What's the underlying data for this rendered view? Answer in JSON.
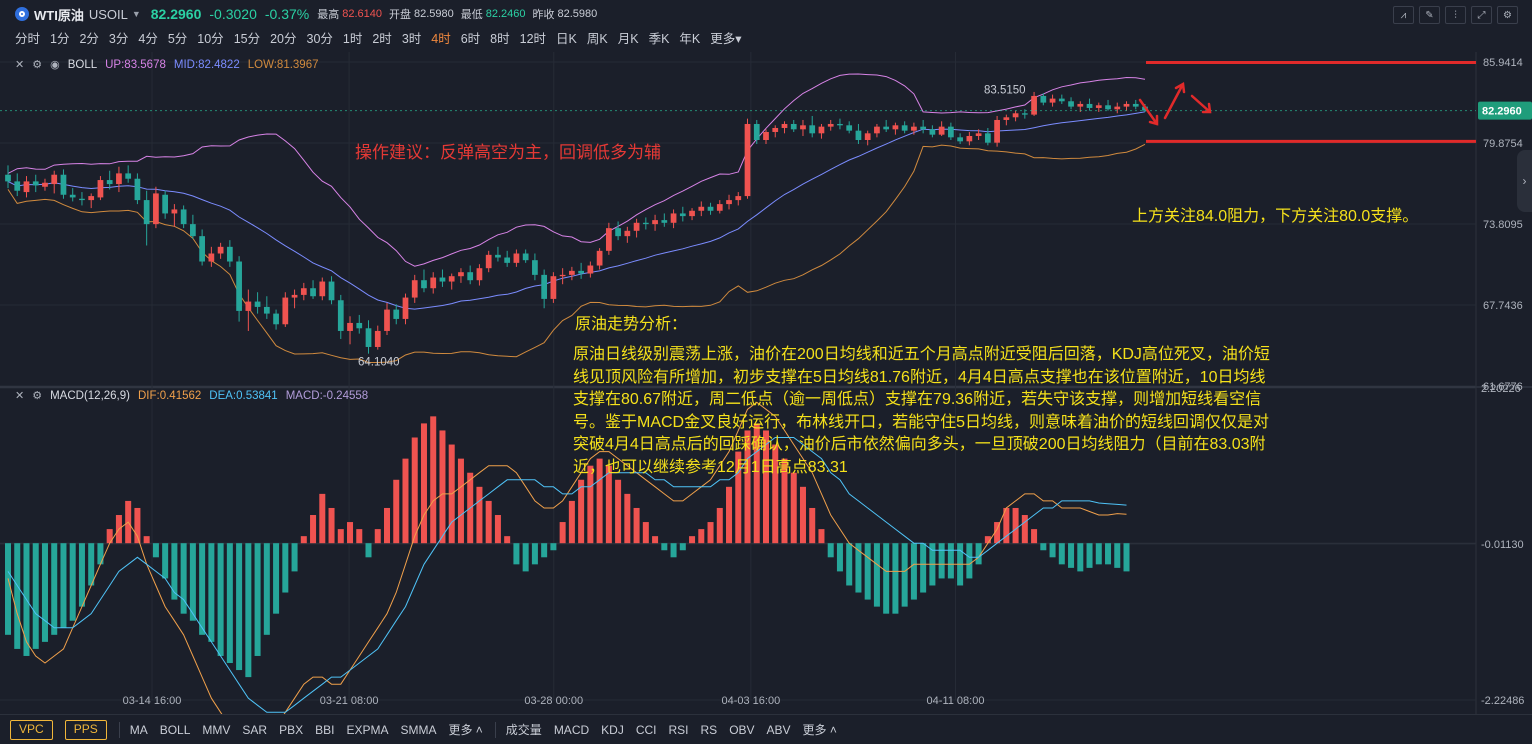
{
  "header": {
    "symbol_name": "WTI原油",
    "symbol_code": "USOIL",
    "price": "82.2960",
    "change": "-0.3020",
    "change_pct": "-0.37%",
    "high_label": "最高",
    "high": "82.6140",
    "open_label": "开盘",
    "open": "82.5980",
    "low_label": "最低",
    "low": "82.2460",
    "prev_label": "昨收",
    "prev": "82.5980"
  },
  "periods": [
    "分时",
    "1分",
    "2分",
    "3分",
    "4分",
    "5分",
    "10分",
    "15分",
    "20分",
    "30分",
    "1时",
    "2时",
    "3时",
    "4时",
    "6时",
    "8时",
    "12时",
    "日K",
    "周K",
    "月K",
    "季K",
    "年K",
    "更多"
  ],
  "active_period": "4时",
  "boll": {
    "name": "BOLL",
    "up": "UP:83.5678",
    "mid": "MID:82.4822",
    "low": "LOW:81.3967"
  },
  "macd": {
    "name": "MACD(12,26,9)",
    "dif": "DIF:0.41562",
    "dea": "DEA:0.53841",
    "macd": "MACD:-0.24558"
  },
  "colors": {
    "up": "#ef5350",
    "down": "#26a69a",
    "boll_up": "#d783e6",
    "boll_mid": "#7b8cff",
    "boll_low": "#d08a3e",
    "dif": "#f0a04b",
    "dea": "#4fc3f7",
    "annotation": "#e53935",
    "text_note": "#f5e11b"
  },
  "chart_data": {
    "type": "candlestick",
    "main_yaxis_ticks": [
      "85.9414",
      "79.8754",
      "73.8095",
      "67.7436",
      "61.6776"
    ],
    "main_ylim": [
      61.6776,
      85.9414
    ],
    "current_price_tag": "82.2960",
    "macd_yaxis_ticks": [
      "2.20226",
      "-0.01130",
      "-2.22486"
    ],
    "macd_ylim": [
      -2.22486,
      2.20226
    ],
    "xaxis_ticks": [
      "03-14 16:00",
      "03-21 08:00",
      "03-28 00:00",
      "04-03 16:00",
      "04-11 08:00"
    ],
    "high_marker": "83.5150",
    "low_marker": "64.1040",
    "resistance_level": 85.9,
    "support_level": 80.0,
    "candles": [
      [
        77.5,
        78.2,
        76.5,
        77.0
      ],
      [
        77.0,
        77.6,
        75.9,
        76.3
      ],
      [
        76.2,
        77.4,
        75.8,
        77.0
      ],
      [
        77.0,
        77.5,
        76.2,
        76.7
      ],
      [
        76.6,
        77.2,
        76.3,
        76.9
      ],
      [
        76.8,
        77.8,
        76.1,
        77.5
      ],
      [
        77.5,
        77.9,
        75.7,
        76.0
      ],
      [
        76.0,
        76.5,
        75.5,
        75.8
      ],
      [
        75.7,
        76.2,
        75.2,
        75.6
      ],
      [
        75.6,
        76.1,
        75.0,
        75.9
      ],
      [
        75.8,
        77.4,
        75.6,
        77.1
      ],
      [
        77.1,
        77.8,
        76.4,
        76.8
      ],
      [
        76.8,
        78.1,
        76.2,
        77.6
      ],
      [
        77.6,
        78.2,
        76.9,
        77.2
      ],
      [
        77.2,
        77.6,
        75.3,
        75.6
      ],
      [
        75.6,
        76.3,
        72.2,
        73.8
      ],
      [
        73.8,
        76.6,
        73.5,
        76.1
      ],
      [
        76.0,
        76.3,
        74.2,
        74.6
      ],
      [
        74.6,
        75.3,
        73.6,
        74.9
      ],
      [
        74.9,
        75.2,
        73.5,
        73.8
      ],
      [
        73.8,
        74.5,
        72.7,
        72.9
      ],
      [
        72.9,
        73.4,
        70.7,
        71.0
      ],
      [
        71.0,
        72.1,
        70.6,
        71.6
      ],
      [
        71.6,
        72.4,
        71.2,
        72.1
      ],
      [
        72.1,
        72.6,
        70.6,
        71.0
      ],
      [
        71.0,
        71.4,
        66.5,
        67.3
      ],
      [
        67.3,
        68.9,
        65.8,
        68.0
      ],
      [
        68.0,
        68.7,
        67.1,
        67.6
      ],
      [
        67.6,
        68.4,
        66.7,
        67.1
      ],
      [
        67.1,
        67.4,
        65.9,
        66.3
      ],
      [
        66.3,
        68.7,
        66.1,
        68.3
      ],
      [
        68.3,
        68.9,
        67.5,
        68.5
      ],
      [
        68.5,
        69.4,
        68.1,
        69.0
      ],
      [
        69.0,
        69.6,
        68.2,
        68.4
      ],
      [
        68.4,
        69.8,
        68.1,
        69.5
      ],
      [
        69.5,
        69.9,
        67.8,
        68.1
      ],
      [
        68.1,
        68.5,
        65.2,
        65.8
      ],
      [
        65.8,
        66.9,
        64.8,
        66.4
      ],
      [
        66.4,
        67.0,
        65.6,
        66.0
      ],
      [
        66.0,
        66.6,
        64.1,
        64.6
      ],
      [
        64.6,
        66.2,
        64.4,
        65.8
      ],
      [
        65.8,
        67.9,
        65.5,
        67.4
      ],
      [
        67.4,
        67.8,
        66.3,
        66.7
      ],
      [
        66.7,
        68.6,
        66.3,
        68.3
      ],
      [
        68.3,
        70.0,
        67.9,
        69.6
      ],
      [
        69.6,
        70.4,
        68.7,
        69.0
      ],
      [
        69.0,
        70.2,
        68.6,
        69.8
      ],
      [
        69.8,
        70.4,
        69.1,
        69.5
      ],
      [
        69.5,
        70.1,
        68.9,
        69.9
      ],
      [
        69.9,
        70.5,
        69.4,
        70.2
      ],
      [
        70.2,
        70.7,
        69.3,
        69.6
      ],
      [
        69.6,
        70.8,
        69.2,
        70.5
      ],
      [
        70.5,
        71.8,
        70.2,
        71.5
      ],
      [
        71.5,
        72.1,
        71.0,
        71.3
      ],
      [
        71.3,
        71.8,
        70.6,
        70.9
      ],
      [
        70.9,
        71.9,
        70.6,
        71.6
      ],
      [
        71.6,
        71.9,
        70.9,
        71.1
      ],
      [
        71.1,
        71.6,
        69.6,
        70.0
      ],
      [
        70.0,
        70.4,
        67.5,
        68.2
      ],
      [
        68.2,
        70.2,
        67.9,
        69.9
      ],
      [
        69.9,
        70.5,
        69.3,
        70.0
      ],
      [
        70.0,
        70.6,
        69.6,
        70.3
      ],
      [
        70.3,
        70.9,
        69.7,
        70.1
      ],
      [
        70.1,
        71.0,
        69.8,
        70.7
      ],
      [
        70.7,
        72.0,
        70.4,
        71.8
      ],
      [
        71.8,
        73.9,
        71.5,
        73.5
      ],
      [
        73.5,
        74.0,
        72.6,
        72.9
      ],
      [
        72.9,
        73.6,
        72.4,
        73.3
      ],
      [
        73.3,
        74.2,
        72.8,
        73.9
      ],
      [
        73.9,
        74.3,
        73.4,
        73.8
      ],
      [
        73.8,
        74.5,
        73.3,
        74.1
      ],
      [
        74.1,
        74.6,
        73.6,
        73.9
      ],
      [
        73.9,
        74.9,
        73.5,
        74.6
      ],
      [
        74.6,
        75.1,
        74.0,
        74.4
      ],
      [
        74.4,
        75.0,
        74.1,
        74.8
      ],
      [
        74.8,
        75.5,
        74.4,
        75.1
      ],
      [
        75.1,
        75.4,
        74.5,
        74.8
      ],
      [
        74.8,
        75.6,
        74.6,
        75.3
      ],
      [
        75.3,
        76.0,
        74.9,
        75.6
      ],
      [
        75.6,
        76.2,
        75.2,
        75.9
      ],
      [
        75.9,
        81.7,
        75.7,
        81.3
      ],
      [
        81.3,
        81.6,
        79.8,
        80.1
      ],
      [
        80.1,
        80.9,
        79.8,
        80.7
      ],
      [
        80.7,
        81.2,
        80.3,
        81.0
      ],
      [
        81.0,
        81.5,
        80.6,
        81.3
      ],
      [
        81.3,
        81.6,
        80.7,
        80.9
      ],
      [
        80.9,
        81.6,
        80.4,
        81.2
      ],
      [
        81.2,
        81.9,
        80.3,
        80.6
      ],
      [
        80.6,
        81.3,
        80.2,
        81.1
      ],
      [
        81.1,
        81.6,
        80.8,
        81.3
      ],
      [
        81.3,
        81.7,
        80.9,
        81.2
      ],
      [
        81.2,
        81.5,
        80.6,
        80.8
      ],
      [
        80.8,
        81.3,
        79.8,
        80.1
      ],
      [
        80.1,
        80.8,
        79.7,
        80.6
      ],
      [
        80.6,
        81.3,
        80.3,
        81.1
      ],
      [
        81.1,
        81.6,
        80.7,
        80.9
      ],
      [
        80.9,
        81.4,
        80.5,
        81.2
      ],
      [
        81.2,
        81.5,
        80.6,
        80.8
      ],
      [
        80.8,
        81.4,
        80.5,
        81.1
      ],
      [
        81.1,
        81.6,
        80.6,
        80.9
      ],
      [
        80.9,
        81.2,
        80.3,
        80.5
      ],
      [
        80.5,
        81.5,
        80.4,
        81.1
      ],
      [
        81.1,
        81.4,
        80.1,
        80.3
      ],
      [
        80.3,
        80.6,
        79.8,
        80.0
      ],
      [
        80.0,
        80.7,
        79.7,
        80.4
      ],
      [
        80.4,
        80.9,
        80.1,
        80.6
      ],
      [
        80.6,
        81.0,
        79.7,
        79.9
      ],
      [
        79.9,
        81.9,
        79.6,
        81.6
      ],
      [
        81.6,
        82.0,
        81.2,
        81.8
      ],
      [
        81.8,
        82.3,
        81.5,
        82.1
      ],
      [
        82.1,
        82.4,
        81.7,
        82.0
      ],
      [
        82.0,
        83.7,
        81.9,
        83.4
      ],
      [
        83.4,
        83.6,
        82.7,
        82.9
      ],
      [
        82.9,
        83.5,
        82.6,
        83.2
      ],
      [
        83.2,
        83.5,
        82.8,
        83.0
      ],
      [
        83.0,
        83.3,
        82.4,
        82.6
      ],
      [
        82.6,
        83.0,
        82.2,
        82.8
      ],
      [
        82.8,
        83.2,
        82.3,
        82.5
      ],
      [
        82.5,
        82.9,
        82.2,
        82.7
      ],
      [
        82.7,
        83.1,
        82.3,
        82.4
      ],
      [
        82.4,
        82.9,
        82.1,
        82.6
      ],
      [
        82.6,
        83.0,
        82.3,
        82.8
      ],
      [
        82.8,
        83.1,
        82.4,
        82.6
      ],
      [
        82.6,
        82.8,
        82.2,
        82.3
      ]
    ],
    "macd_hist": [
      -1.3,
      -1.5,
      -1.6,
      -1.5,
      -1.4,
      -1.3,
      -1.2,
      -1.1,
      -0.9,
      -0.6,
      -0.3,
      0.2,
      0.4,
      0.6,
      0.5,
      0.1,
      -0.2,
      -0.5,
      -0.8,
      -1.0,
      -1.1,
      -1.3,
      -1.4,
      -1.6,
      -1.7,
      -1.8,
      -1.9,
      -1.6,
      -1.3,
      -1.0,
      -0.7,
      -0.4,
      0.1,
      0.4,
      0.7,
      0.5,
      0.2,
      0.3,
      0.2,
      -0.2,
      0.2,
      0.5,
      0.9,
      1.2,
      1.5,
      1.7,
      1.8,
      1.6,
      1.4,
      1.2,
      1.0,
      0.8,
      0.6,
      0.4,
      0.1,
      -0.3,
      -0.4,
      -0.3,
      -0.2,
      -0.1,
      0.3,
      0.6,
      0.9,
      1.1,
      1.2,
      1.1,
      0.9,
      0.7,
      0.5,
      0.3,
      0.1,
      -0.1,
      -0.2,
      -0.1,
      0.1,
      0.2,
      0.3,
      0.5,
      0.8,
      1.3,
      1.6,
      1.7,
      1.6,
      1.4,
      1.2,
      1.0,
      0.8,
      0.5,
      0.2,
      -0.2,
      -0.4,
      -0.6,
      -0.7,
      -0.8,
      -0.9,
      -1.0,
      -1.0,
      -0.9,
      -0.8,
      -0.7,
      -0.6,
      -0.5,
      -0.5,
      -0.6,
      -0.5,
      -0.3,
      0.1,
      0.3,
      0.5,
      0.5,
      0.4,
      0.2,
      -0.1,
      -0.2,
      -0.3,
      -0.35,
      -0.4,
      -0.35,
      -0.3,
      -0.3,
      -0.35,
      -0.4
    ],
    "dif": [
      -0.5,
      -1.0,
      -1.4,
      -1.6,
      -1.7,
      -1.6,
      -1.5,
      -1.2,
      -0.9,
      -0.6,
      -0.3,
      0.0,
      0.2,
      0.3,
      0.1,
      -0.3,
      -0.6,
      -0.9,
      -1.1,
      -1.3,
      -1.6,
      -1.9,
      -2.2,
      -2.4,
      -2.6,
      -2.8,
      -2.9,
      -2.9,
      -2.8,
      -2.6,
      -2.4,
      -2.2,
      -2.0,
      -1.9,
      -1.9,
      -2.0,
      -2.0,
      -1.8,
      -1.6,
      -1.4,
      -1.2,
      -1.0,
      -0.7,
      -0.3,
      0.1,
      0.4,
      0.6,
      0.7,
      0.7,
      0.8,
      0.9,
      1.0,
      1.1,
      1.1,
      1.1,
      1.0,
      0.8,
      0.6,
      0.5,
      0.5,
      0.6,
      0.8,
      1.0,
      1.2,
      1.3,
      1.3,
      1.2,
      1.1,
      1.0,
      0.9,
      0.8,
      0.7,
      0.6,
      0.6,
      0.7,
      0.8,
      0.9,
      1.1,
      1.3,
      1.6,
      1.9,
      2.0,
      1.9,
      1.8,
      1.6,
      1.4,
      1.2,
      1.0,
      0.7,
      0.4,
      0.2,
      0.0,
      -0.1,
      -0.2,
      -0.3,
      -0.4,
      -0.4,
      -0.4,
      -0.3,
      -0.3,
      -0.3,
      -0.3,
      -0.3,
      -0.3,
      -0.3,
      -0.2,
      0.0,
      0.2,
      0.5,
      0.6,
      0.7,
      0.7,
      0.6,
      0.6,
      0.5,
      0.5,
      0.5,
      0.45,
      0.4,
      0.4,
      0.42,
      0.41
    ],
    "dea": [
      -0.4,
      -0.6,
      -0.8,
      -1.0,
      -1.1,
      -1.2,
      -1.2,
      -1.2,
      -1.1,
      -1.0,
      -0.8,
      -0.6,
      -0.4,
      -0.3,
      -0.2,
      -0.3,
      -0.4,
      -0.5,
      -0.7,
      -0.8,
      -1.0,
      -1.2,
      -1.4,
      -1.6,
      -1.8,
      -2.0,
      -2.2,
      -2.3,
      -2.4,
      -2.4,
      -2.4,
      -2.3,
      -2.2,
      -2.1,
      -2.0,
      -1.9,
      -1.9,
      -1.8,
      -1.7,
      -1.6,
      -1.5,
      -1.3,
      -1.1,
      -0.9,
      -0.6,
      -0.3,
      -0.1,
      0.1,
      0.3,
      0.4,
      0.5,
      0.6,
      0.7,
      0.8,
      0.9,
      0.9,
      0.9,
      0.9,
      0.8,
      0.8,
      0.7,
      0.7,
      0.8,
      0.8,
      0.9,
      1.0,
      1.0,
      1.0,
      1.0,
      1.0,
      0.9,
      0.9,
      0.8,
      0.8,
      0.8,
      0.8,
      0.8,
      0.9,
      0.9,
      1.0,
      1.2,
      1.3,
      1.4,
      1.5,
      1.5,
      1.5,
      1.4,
      1.3,
      1.2,
      1.0,
      0.9,
      0.7,
      0.6,
      0.5,
      0.4,
      0.3,
      0.2,
      0.1,
      0.0,
      0.0,
      -0.1,
      -0.1,
      -0.1,
      -0.1,
      -0.2,
      -0.2,
      -0.1,
      0.0,
      0.1,
      0.2,
      0.3,
      0.4,
      0.5,
      0.5,
      0.6,
      0.6,
      0.6,
      0.6,
      0.57,
      0.56,
      0.55,
      0.54
    ]
  },
  "annotations": {
    "advice": "操作建议：反弹高空为主，回调低多为辅",
    "levels_note": "上方关注84.0阻力，下方关注80.0支撑。",
    "analysis_title": "原油走势分析：",
    "analysis_body": "原油日线级别震荡上涨，油价在200日均线和近五个月高点附近受阻后回落，KDJ高位死叉，油价短线见顶风险有所增加，初步支撑在5日均线81.76附近，4月4日高点支撑也在该位置附近，10日均线支撑在80.67附近，周二低点（逾一周低点）支撑在79.36附近，若失守该支撑，则增加短线看空信号。鉴于MACD金叉良好运行，布林线开口，若能守住5日均线，则意味着油价的短线回调仅仅是对突破4月4日高点后的回踩确认，油价后市依然偏向多头，一旦顶破200日均线阻力（目前在83.03附近，也可以继续参考12月1日高点83.31"
  },
  "bottom": {
    "vol_buttons": [
      "VPC",
      "PPS"
    ],
    "main_indicators": [
      "MA",
      "BOLL",
      "MMV",
      "SAR",
      "PBX",
      "BBI",
      "EXPMA",
      "SMMA",
      "更多"
    ],
    "sub_indicators": [
      "成交量",
      "MACD",
      "KDJ",
      "CCI",
      "RSI",
      "RS",
      "OBV",
      "ABV",
      "更多"
    ]
  }
}
